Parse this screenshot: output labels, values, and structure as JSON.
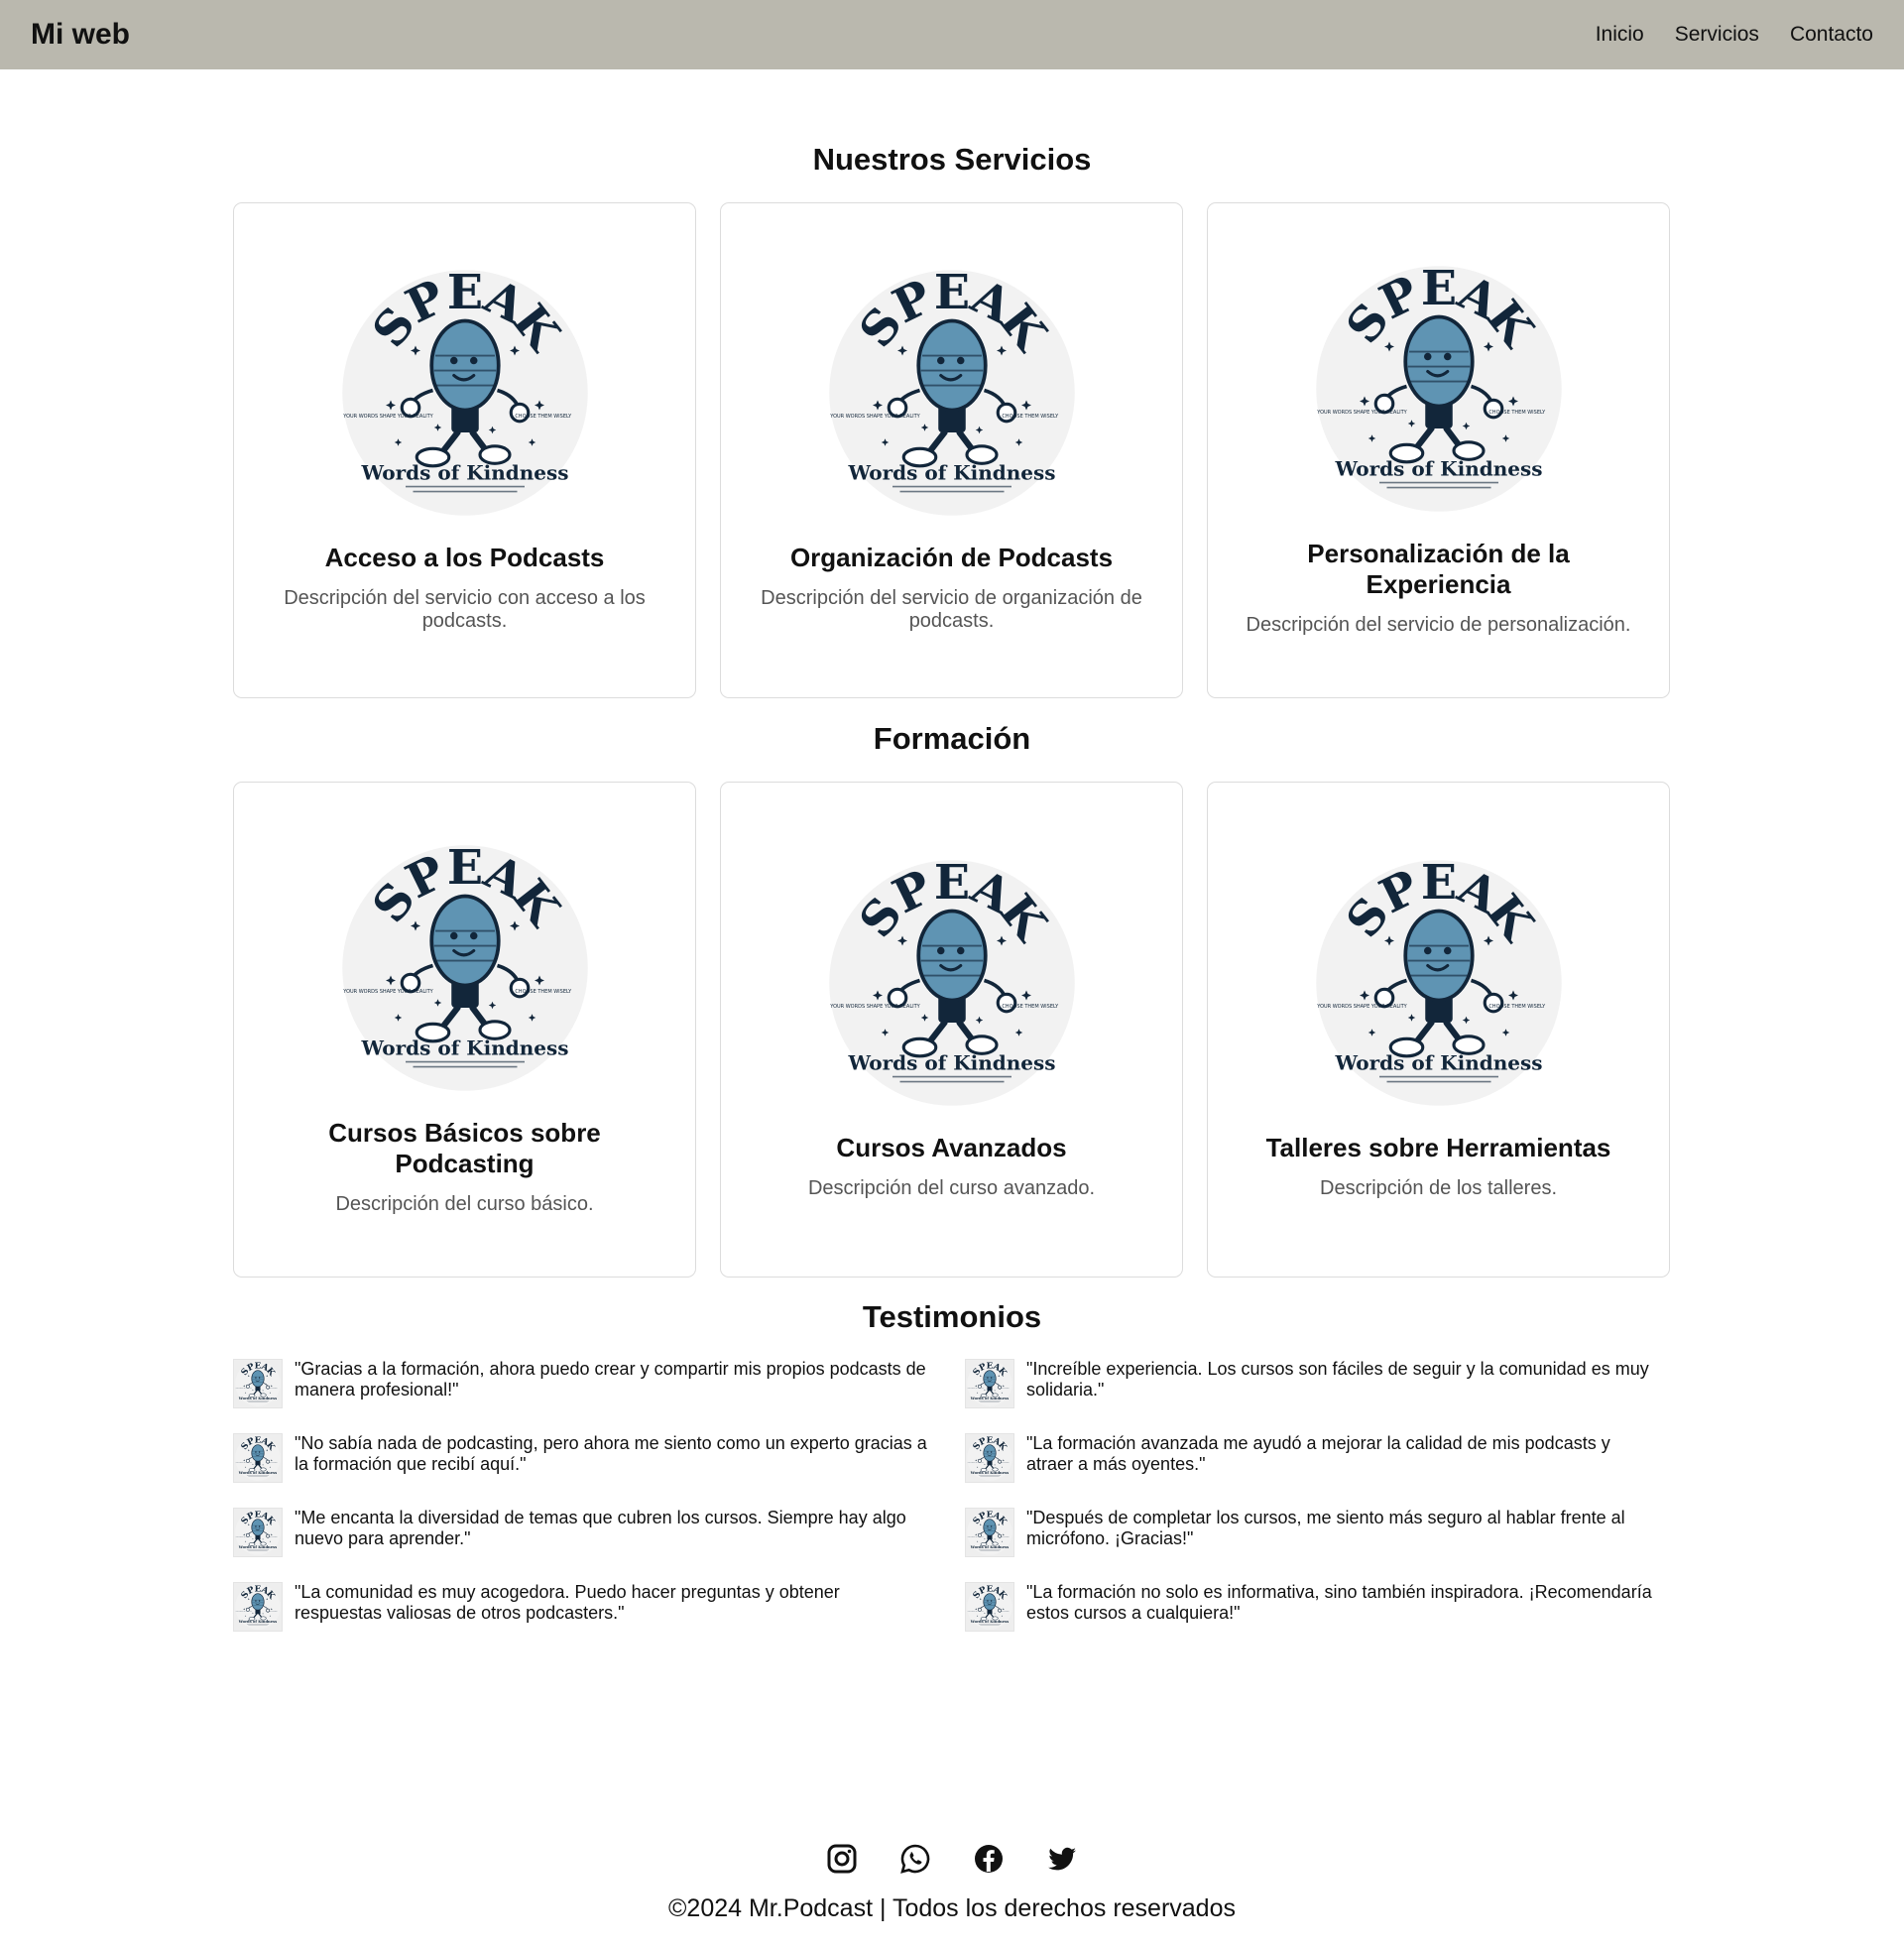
{
  "header": {
    "brand": "Mi web",
    "nav": [
      "Inicio",
      "Servicios",
      "Contacto"
    ]
  },
  "logo": {
    "word": "SPEAK",
    "tagline": "Words of Kindness",
    "side_left": "YOUR WORDS SHAPE YOUR REALITY",
    "side_right": "CHOOSE THEM WISELY"
  },
  "services": {
    "title": "Nuestros Servicios",
    "cards": [
      {
        "title": "Acceso a los Podcasts",
        "desc": "Descripción del servicio con acceso a los podcasts."
      },
      {
        "title": "Organización de Podcasts",
        "desc": "Descripción del servicio de organización de podcasts."
      },
      {
        "title": "Personalización de la Experiencia",
        "desc": "Descripción del servicio de personalización."
      }
    ]
  },
  "training": {
    "title": "Formación",
    "cards": [
      {
        "title": "Cursos Básicos sobre Podcasting",
        "desc": "Descripción del curso básico."
      },
      {
        "title": "Cursos Avanzados",
        "desc": "Descripción del curso avanzado."
      },
      {
        "title": "Talleres sobre Herramientas",
        "desc": "Descripción de los talleres."
      }
    ]
  },
  "testimonials": {
    "title": "Testimonios",
    "items": [
      "\"Gracias a la formación, ahora puedo crear y compartir mis propios podcasts de manera profesional!\"",
      "\"Increíble experiencia. Los cursos son fáciles de seguir y la comunidad es muy solidaria.\"",
      "\"No sabía nada de podcasting, pero ahora me siento como un experto gracias a la formación que recibí aquí.\"",
      "\"La formación avanzada me ayudó a mejorar la calidad de mis podcasts y atraer a más oyentes.\"",
      "\"Me encanta la diversidad de temas que cubren los cursos. Siempre hay algo nuevo para aprender.\"",
      "\"Después de completar los cursos, me siento más seguro al hablar frente al micrófono. ¡Gracias!\"",
      "\"La comunidad es muy acogedora. Puedo hacer preguntas y obtener respuestas valiosas de otros podcasters.\"",
      "\"La formación no solo es informativa, sino también inspiradora. ¡Recomendaría estos cursos a cualquiera!\""
    ]
  },
  "footer": {
    "socials": [
      "instagram-icon",
      "whatsapp-icon",
      "facebook-icon",
      "twitter-icon"
    ],
    "copyright": "©2024 Mr.Podcast | Todos los derechos reservados"
  },
  "colors": {
    "header_bg": "#bab8ae",
    "logo_navy": "#12263a",
    "logo_blue": "#5f94b3"
  }
}
